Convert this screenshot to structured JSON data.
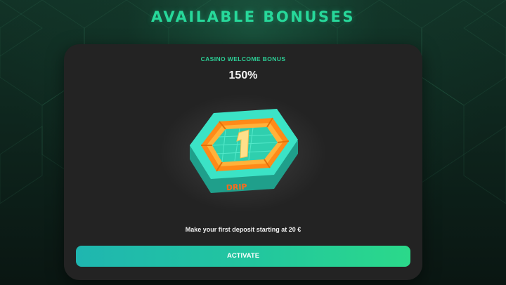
{
  "page": {
    "title": "AVAILABLE BONUSES"
  },
  "bonus": {
    "type_label": "CASINO WELCOME BONUS",
    "percent": "150%",
    "image_label": "DRIP",
    "image_number": "1",
    "description": "Make your first deposit starting at 20 €",
    "activate_label": "ACTIVATE"
  },
  "colors": {
    "accent": "#27d89a",
    "card_bg": "#232323",
    "button_start": "#1fb6b0",
    "button_end": "#2bd98a",
    "image_teal": "#35dcc0",
    "image_orange": "#ff8a18"
  },
  "icons": {
    "bonus_image": "hexagon-badge-icon"
  }
}
